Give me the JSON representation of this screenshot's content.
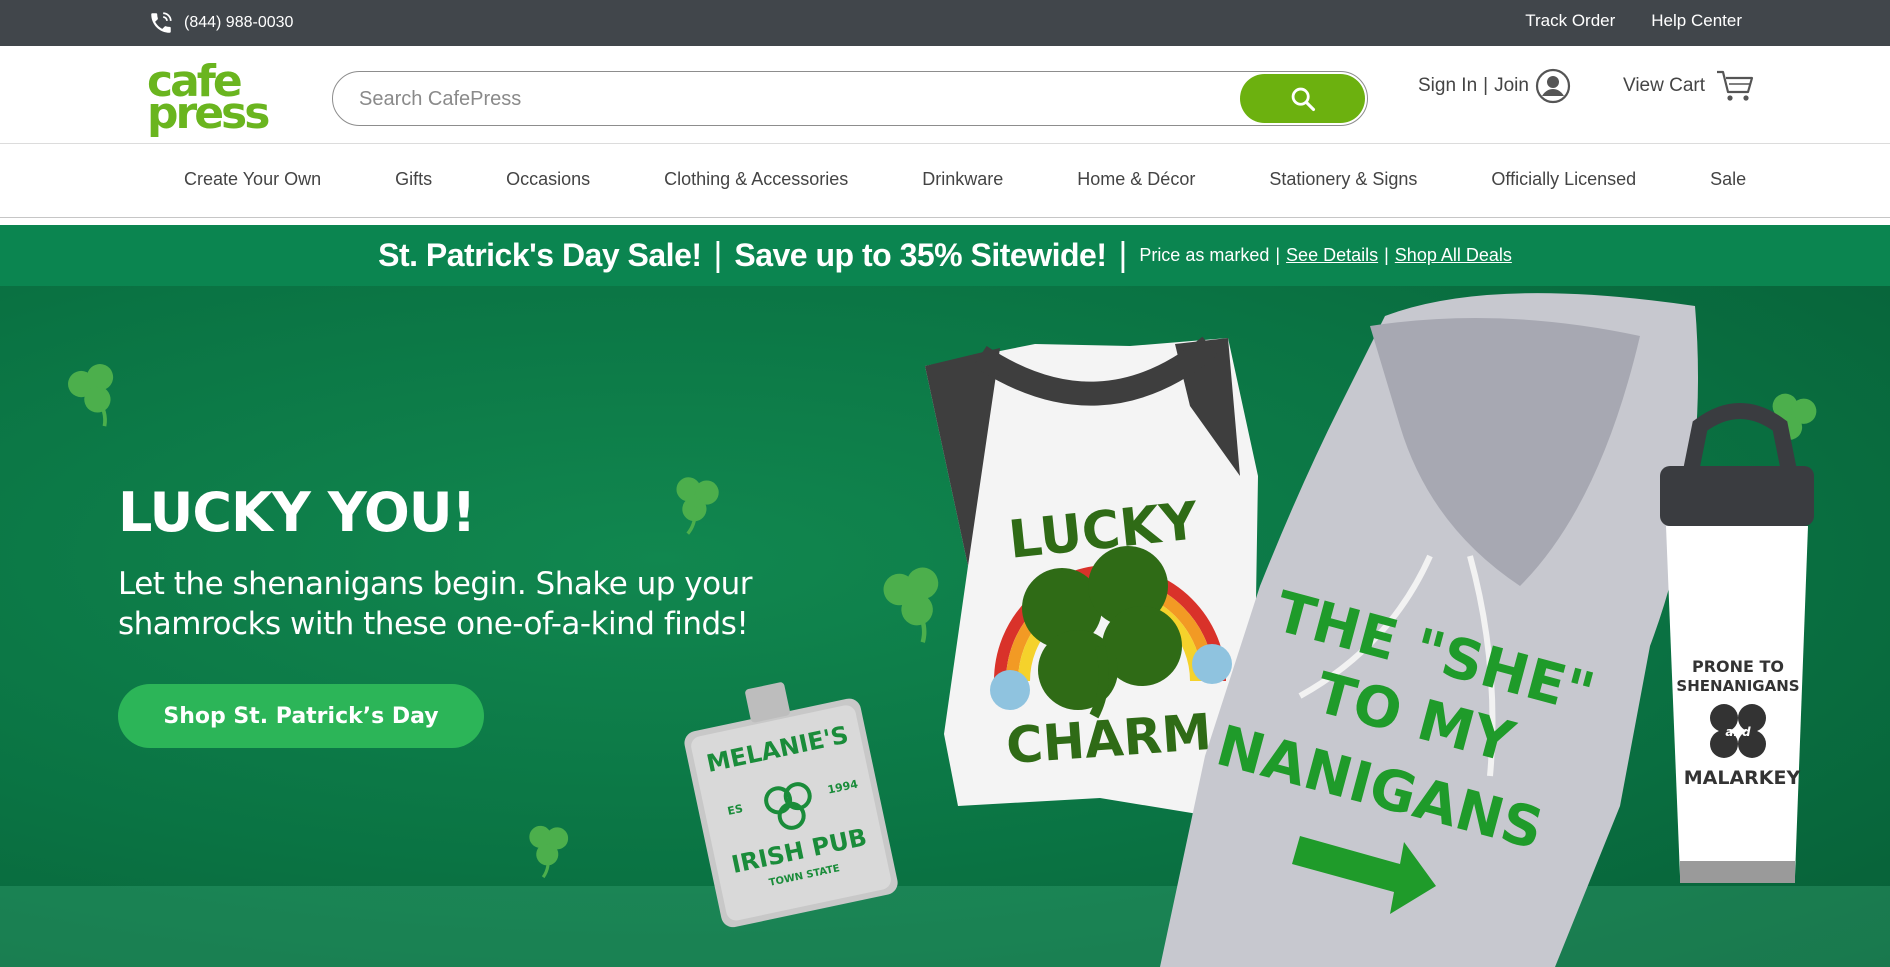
{
  "topbar": {
    "phone": "(844) 988-0030",
    "track_order": "Track Order",
    "help_center": "Help Center"
  },
  "header": {
    "logo_line1": "cafe",
    "logo_line2": "press",
    "search_placeholder": "Search CafePress",
    "sign_in": "Sign In",
    "divider": "|",
    "join": "Join",
    "view_cart": "View Cart"
  },
  "nav": {
    "items": [
      "Create Your Own",
      "Gifts",
      "Occasions",
      "Clothing & Accessories",
      "Drinkware",
      "Home & Décor",
      "Stationery & Signs",
      "Officially Licensed",
      "Sale"
    ]
  },
  "promo": {
    "headline": "St. Patrick's Day Sale!",
    "separator": "|",
    "offer": "Save up to 35% Sitewide!",
    "price_note": "Price as marked",
    "see_details": "See Details",
    "shop_all": "Shop All Deals"
  },
  "hero": {
    "title": "LUCKY YOU!",
    "subtitle": "Let the shenanigans begin. Shake up your shamrocks with these one-of-a-kind finds!",
    "cta": "Shop St. Patrick’s Day",
    "shirt_line1": "LUCKY",
    "shirt_line2": "CHARM",
    "hoodie_line1": "THE \"SHE\"",
    "hoodie_line2": "TO MY",
    "hoodie_line3": "NANIGANS",
    "flask_line1": "MELANIE'S",
    "flask_es": "ES",
    "flask_year": "1994",
    "flask_line2": "IRISH PUB",
    "flask_line3": "TOWN STATE",
    "tumbler_line1": "PRONE TO",
    "tumbler_line2": "SHENANIGANS",
    "tumbler_and": "and",
    "tumbler_line3": "MALARKEY"
  },
  "colors": {
    "topbar": "#41464b",
    "brand_green": "#6ab51f",
    "promo_green": "#0b8550",
    "hero_green": "#0a7343",
    "cta_green": "#2cb558"
  },
  "icons": {
    "phone": "phone-icon",
    "search": "search-icon",
    "account": "user-circle-icon",
    "cart": "cart-icon"
  }
}
